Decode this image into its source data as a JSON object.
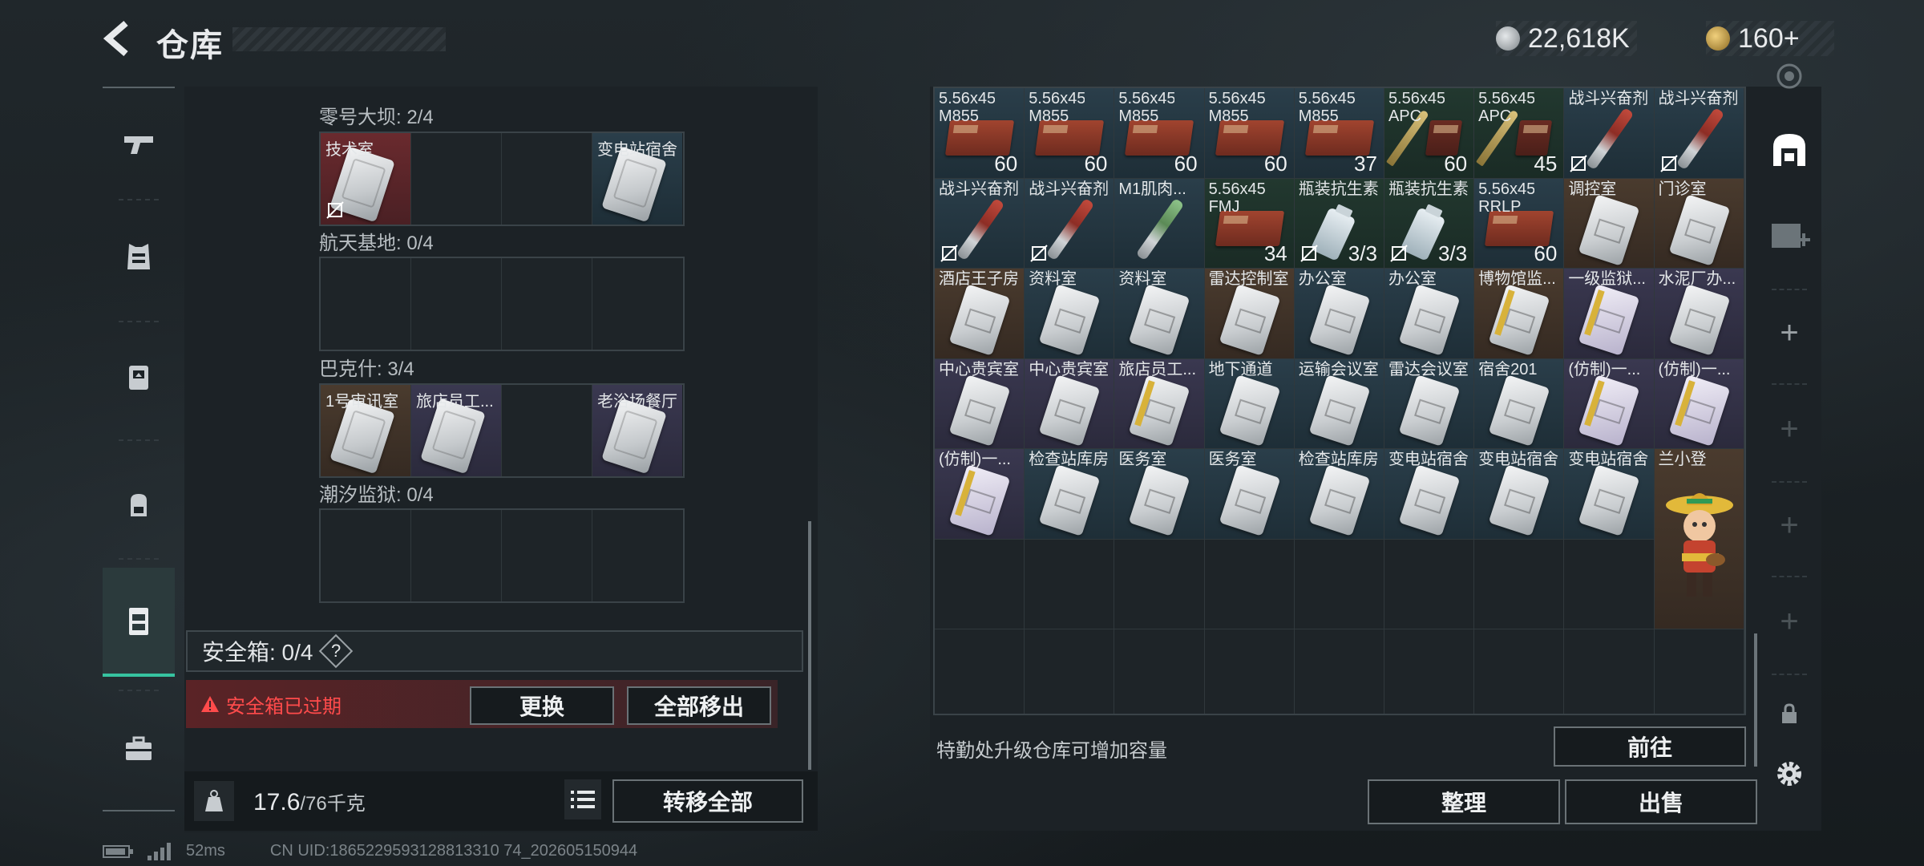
{
  "header": {
    "title": "仓库"
  },
  "currency": [
    {
      "icon": "silver-coin-icon",
      "value": "22,618K",
      "color": "#c9cdd0"
    },
    {
      "icon": "gold-coin-icon",
      "value": "160+",
      "color": "#d7b35a"
    }
  ],
  "left_nav": [
    "gun-icon",
    "armor-vest-icon",
    "chest-rig-icon",
    "backpack-icon",
    "safe-case-icon",
    "toolbox-icon"
  ],
  "key_sections": [
    {
      "label": "零号大坝: 2/4",
      "slots": [
        {
          "name": "技术室",
          "style": "red",
          "no_carry": true
        },
        {
          "name": "",
          "style": "empty"
        },
        {
          "name": "",
          "style": "empty"
        },
        {
          "name": "变电站宿舍",
          "style": "blue"
        }
      ]
    },
    {
      "label": "航天基地: 0/4",
      "slots": [
        {
          "name": "",
          "style": "empty"
        },
        {
          "name": "",
          "style": "empty"
        },
        {
          "name": "",
          "style": "empty"
        },
        {
          "name": "",
          "style": "empty"
        }
      ]
    },
    {
      "label": "巴克什: 3/4",
      "slots": [
        {
          "name": "1号审讯室",
          "style": "brown"
        },
        {
          "name": "旅店员工...",
          "style": "purple"
        },
        {
          "name": "",
          "style": "empty"
        },
        {
          "name": "老浴场餐厅",
          "style": "purple"
        }
      ]
    },
    {
      "label": "潮汐监狱: 0/4",
      "slots": [
        {
          "name": "",
          "style": "empty"
        },
        {
          "name": "",
          "style": "empty"
        },
        {
          "name": "",
          "style": "empty"
        },
        {
          "name": "",
          "style": "empty"
        }
      ]
    }
  ],
  "safebox": {
    "label": "安全箱: 0/4",
    "help": "?",
    "warning": "安全箱已过期",
    "replace": "更换",
    "remove_all": "全部移出"
  },
  "weight": {
    "current": "17.6",
    "max": "/76千克",
    "transfer_all": "转移全部"
  },
  "storage": {
    "items": [
      {
        "name": "5.56x45 M855",
        "kind": "ammo",
        "bg": "blue",
        "count": "60"
      },
      {
        "name": "5.56x45 M855",
        "kind": "ammo",
        "bg": "blue",
        "count": "60"
      },
      {
        "name": "5.56x45 M855",
        "kind": "ammo",
        "bg": "blue",
        "count": "60"
      },
      {
        "name": "5.56x45 M855",
        "kind": "ammo",
        "bg": "blue",
        "count": "60"
      },
      {
        "name": "5.56x45 M855",
        "kind": "ammo",
        "bg": "blue",
        "count": "37"
      },
      {
        "name": "5.56x45 APC",
        "kind": "apc",
        "bg": "green",
        "count": "60"
      },
      {
        "name": "5.56x45 APC",
        "kind": "apc",
        "bg": "green",
        "count": "45"
      },
      {
        "name": "战斗兴奋剂",
        "kind": "syringe",
        "bg": "blue",
        "count": "",
        "no_carry": true
      },
      {
        "name": "战斗兴奋剂",
        "kind": "syringe",
        "bg": "blue",
        "count": "",
        "no_carry": true
      },
      {
        "name": "战斗兴奋剂",
        "kind": "syringe",
        "bg": "blue",
        "count": "",
        "no_carry": true
      },
      {
        "name": "战斗兴奋剂",
        "kind": "syringe",
        "bg": "blue",
        "count": "",
        "no_carry": true
      },
      {
        "name": "M1肌肉...",
        "kind": "syringe-green",
        "bg": "blue",
        "count": ""
      },
      {
        "name": "5.56x45 FMJ",
        "kind": "ammo",
        "bg": "green",
        "count": "34"
      },
      {
        "name": "瓶装抗生素",
        "kind": "bottle",
        "bg": "green",
        "count": "3/3",
        "no_carry": true
      },
      {
        "name": "瓶装抗生素",
        "kind": "bottle",
        "bg": "green",
        "count": "3/3",
        "no_carry": true
      },
      {
        "name": "5.56x45 RRLP",
        "kind": "ammo",
        "bg": "blue",
        "count": "60"
      },
      {
        "name": "调控室",
        "kind": "keycard",
        "bg": "brown",
        "count": ""
      },
      {
        "name": "门诊室",
        "kind": "keycard",
        "bg": "brown",
        "count": ""
      },
      {
        "name": "酒店王子房",
        "kind": "keycard",
        "bg": "brown",
        "count": ""
      },
      {
        "name": "资料室",
        "kind": "keycard",
        "bg": "blue",
        "count": ""
      },
      {
        "name": "资料室",
        "kind": "keycard",
        "bg": "blue",
        "count": ""
      },
      {
        "name": "雷达控制室",
        "kind": "keycard",
        "bg": "brown",
        "count": ""
      },
      {
        "name": "办公室",
        "kind": "keycard",
        "bg": "blue",
        "count": ""
      },
      {
        "name": "办公室",
        "kind": "keycard",
        "bg": "blue",
        "count": ""
      },
      {
        "name": "博物馆监...",
        "kind": "keycard-gold",
        "bg": "brown",
        "count": ""
      },
      {
        "name": "一级监狱...",
        "kind": "keycard-violet",
        "bg": "purple",
        "count": ""
      },
      {
        "name": "水泥厂办...",
        "kind": "keycard",
        "bg": "purple",
        "count": ""
      },
      {
        "name": "中心贵宾室",
        "kind": "keycard",
        "bg": "purple",
        "count": ""
      },
      {
        "name": "中心贵宾室",
        "kind": "keycard",
        "bg": "purple",
        "count": ""
      },
      {
        "name": "旅店员工...",
        "kind": "keycard-gold",
        "bg": "purple",
        "count": ""
      },
      {
        "name": "地下通道",
        "kind": "keycard",
        "bg": "blue",
        "count": ""
      },
      {
        "name": "运输会议室",
        "kind": "keycard",
        "bg": "blue",
        "count": ""
      },
      {
        "name": "雷达会议室",
        "kind": "keycard",
        "bg": "blue",
        "count": ""
      },
      {
        "name": "宿舍201",
        "kind": "keycard",
        "bg": "blue",
        "count": ""
      },
      {
        "name": "(仿制)一...",
        "kind": "keycard-violet",
        "bg": "purple",
        "count": ""
      },
      {
        "name": "(仿制)一...",
        "kind": "keycard-violet",
        "bg": "purple",
        "count": ""
      },
      {
        "name": "(仿制)一...",
        "kind": "keycard-violet",
        "bg": "purple",
        "count": ""
      },
      {
        "name": "检查站库房",
        "kind": "keycard",
        "bg": "blue",
        "count": ""
      },
      {
        "name": "医务室",
        "kind": "keycard",
        "bg": "blue",
        "count": ""
      },
      {
        "name": "医务室",
        "kind": "keycard",
        "bg": "blue",
        "count": ""
      },
      {
        "name": "检查站库房",
        "kind": "keycard",
        "bg": "blue",
        "count": ""
      },
      {
        "name": "变电站宿舍",
        "kind": "keycard",
        "bg": "blue",
        "count": ""
      },
      {
        "name": "变电站宿舍",
        "kind": "keycard",
        "bg": "blue",
        "count": ""
      },
      {
        "name": "变电站宿舍",
        "kind": "keycard",
        "bg": "blue",
        "count": ""
      },
      {
        "name": "兰小登",
        "kind": "figure",
        "bg": "brown",
        "count": ""
      }
    ],
    "hint": "特勤处升级仓库可增加容量",
    "goto": "前往",
    "sort": "整理",
    "sell": "出售"
  },
  "right_sidebar": [
    "storage-tab-icon",
    "add-storage-icon",
    "plus-icon",
    "plus-icon",
    "plus-icon",
    "plus-icon",
    "lock-icon",
    "settings-icon"
  ],
  "status_bar": {
    "ping": "52ms",
    "uid": "CN UID:1865229593128813310 74_202605150944"
  }
}
